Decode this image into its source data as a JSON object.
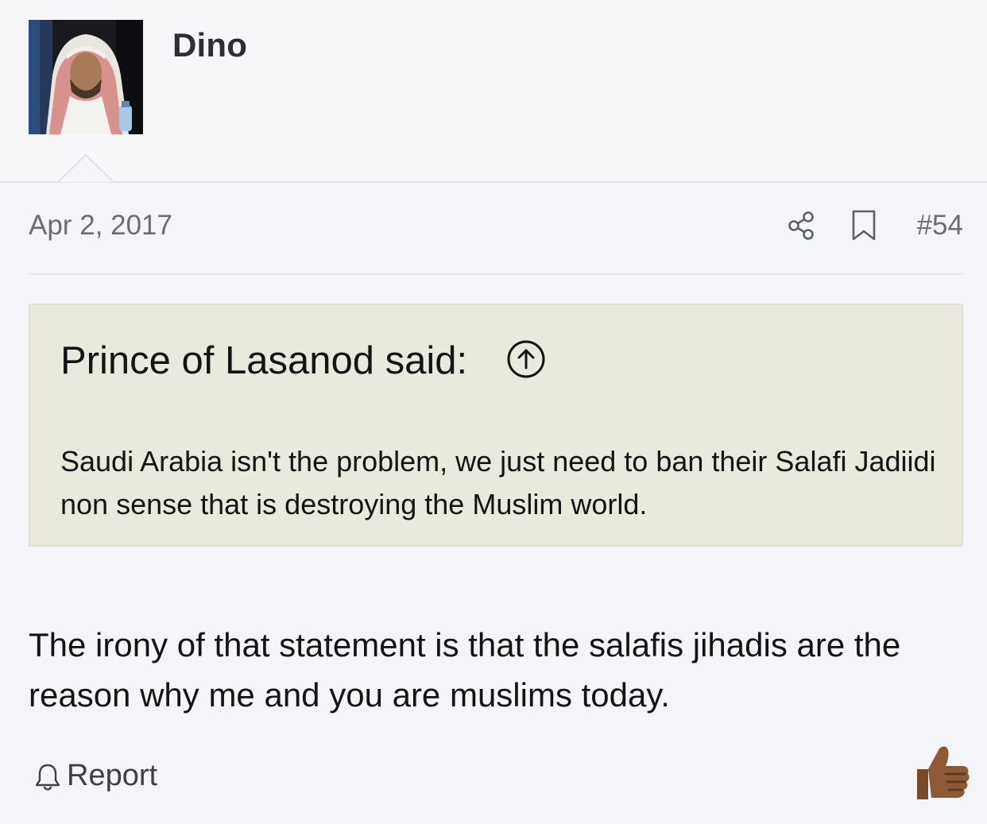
{
  "author": {
    "username": "Dino"
  },
  "post": {
    "date": "Apr 2, 2017",
    "number": "#54",
    "body": "The irony of that statement is that the salafis jihadis are the reason why me and you are muslims today."
  },
  "quote": {
    "attribution": "Prince of Lasanod said:",
    "text": "Saudi Arabia isn't the problem, we just need to ban their Salafi Jadiidi non sense that is destroying the Muslim world."
  },
  "actions": {
    "report_label": "Report",
    "share_icon": "share-icon",
    "bookmark_icon": "bookmark-icon",
    "like_icon": "thumbs-up-icon"
  },
  "colors": {
    "page_background": "#f4f5f9",
    "quote_background": "#eae9de",
    "meta_text": "#6b6e75",
    "username": "#2b2f3a",
    "like_skin": "#8d5a33"
  }
}
